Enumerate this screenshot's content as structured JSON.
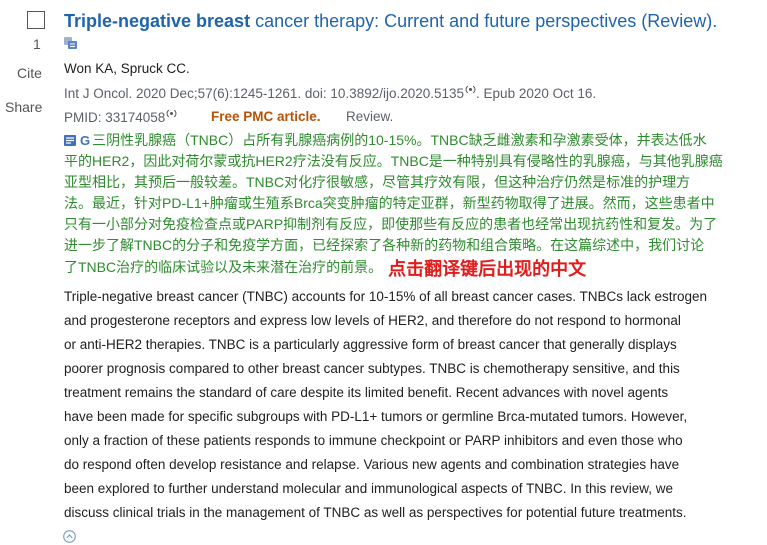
{
  "colors": {
    "title": "#1f64ad",
    "text": "#212121",
    "muted": "#5b616b",
    "free_pmc": "#b45309",
    "translation": "#2e8b2e",
    "annotation": "#e21b1b",
    "icon_blue": "#3f73b9"
  },
  "icons": {
    "checkbox": "checkbox",
    "title_translate": "translate-icon",
    "audio": "audio-icon",
    "translation_toggle": "translate-toggle-icon",
    "google": "google-icon",
    "collapse": "collapse-icon"
  },
  "result": {
    "index": "1",
    "cite_label": "Cite",
    "share_label": "Share",
    "title": {
      "highlight": "Triple-negative breast",
      "rest": " cancer therapy: Current and future perspectives (Review)."
    },
    "authors": "Won KA, Spruck CC.",
    "citation": {
      "source": "Int J Oncol. 2020 Dec;57(6):1245-1261. doi: 10.3892/ijo.2020.5135",
      "epub": ". Epub 2020 Oct 16."
    },
    "pmid": "PMID: 33174058",
    "free_pmc": "Free PMC article.",
    "publication_type": "Review.",
    "translation": {
      "google_logo": "G",
      "lines": [
        "三阴性乳腺癌（TNBC）占所有乳腺癌病例的10-15%。TNBC缺乏雌激素和孕激素受体，并表达低水",
        "平的HER2，因此对荷尔蒙或抗HER2疗法没有反应。TNBC是一种特别具有侵略性的乳腺癌，与其他乳腺癌",
        "亚型相比，其预后一般较差。TNBC对化疗很敏感，尽管其疗效有限，但这种治疗仍然是标准的护理方",
        "法。最近，针对PD-L1+肿瘤或生殖系Brca突变肿瘤的特定亚群，新型药物取得了进展。然而，这些患者中",
        "只有一小部分对免疫检查点或PARP抑制剂有反应，即使那些有反应的患者也经常出现抗药性和复发。为了",
        "进一步了解TNBC的分子和免疫学方面，已经探索了各种新的药物和组合策略。在这篇综述中，我们讨论",
        "了TNBC治疗的临床试验以及未来潜在治疗的前景。"
      ],
      "annotation": "点击翻译键后出现的中文"
    },
    "abstract": {
      "lines": [
        "Triple-negative breast cancer (TNBC) accounts for 10-15% of all breast cancer cases. TNBCs lack estrogen",
        "and progesterone receptors and express low levels of HER2, and therefore do not respond to hormonal",
        "or anti-HER2 therapies. TNBC is a particularly aggressive form of breast cancer that generally displays",
        "poorer prognosis compared to other breast cancer subtypes. TNBC is chemotherapy sensitive, and this",
        "treatment remains the standard of care despite its limited benefit. Recent advances with novel agents",
        "have been made for specific subgroups with PD-L1+ tumors or germline Brca-mutated tumors. However,",
        "only a fraction of these patients responds to immune checkpoint or PARP inhibitors and even those who",
        "do respond often develop resistance and relapse. Various new agents and combination strategies have",
        "been explored to further understand molecular and immunological aspects of TNBC. In this review, we",
        "discuss clinical trials in the management of TNBC as well as perspectives for potential future treatments."
      ]
    }
  }
}
